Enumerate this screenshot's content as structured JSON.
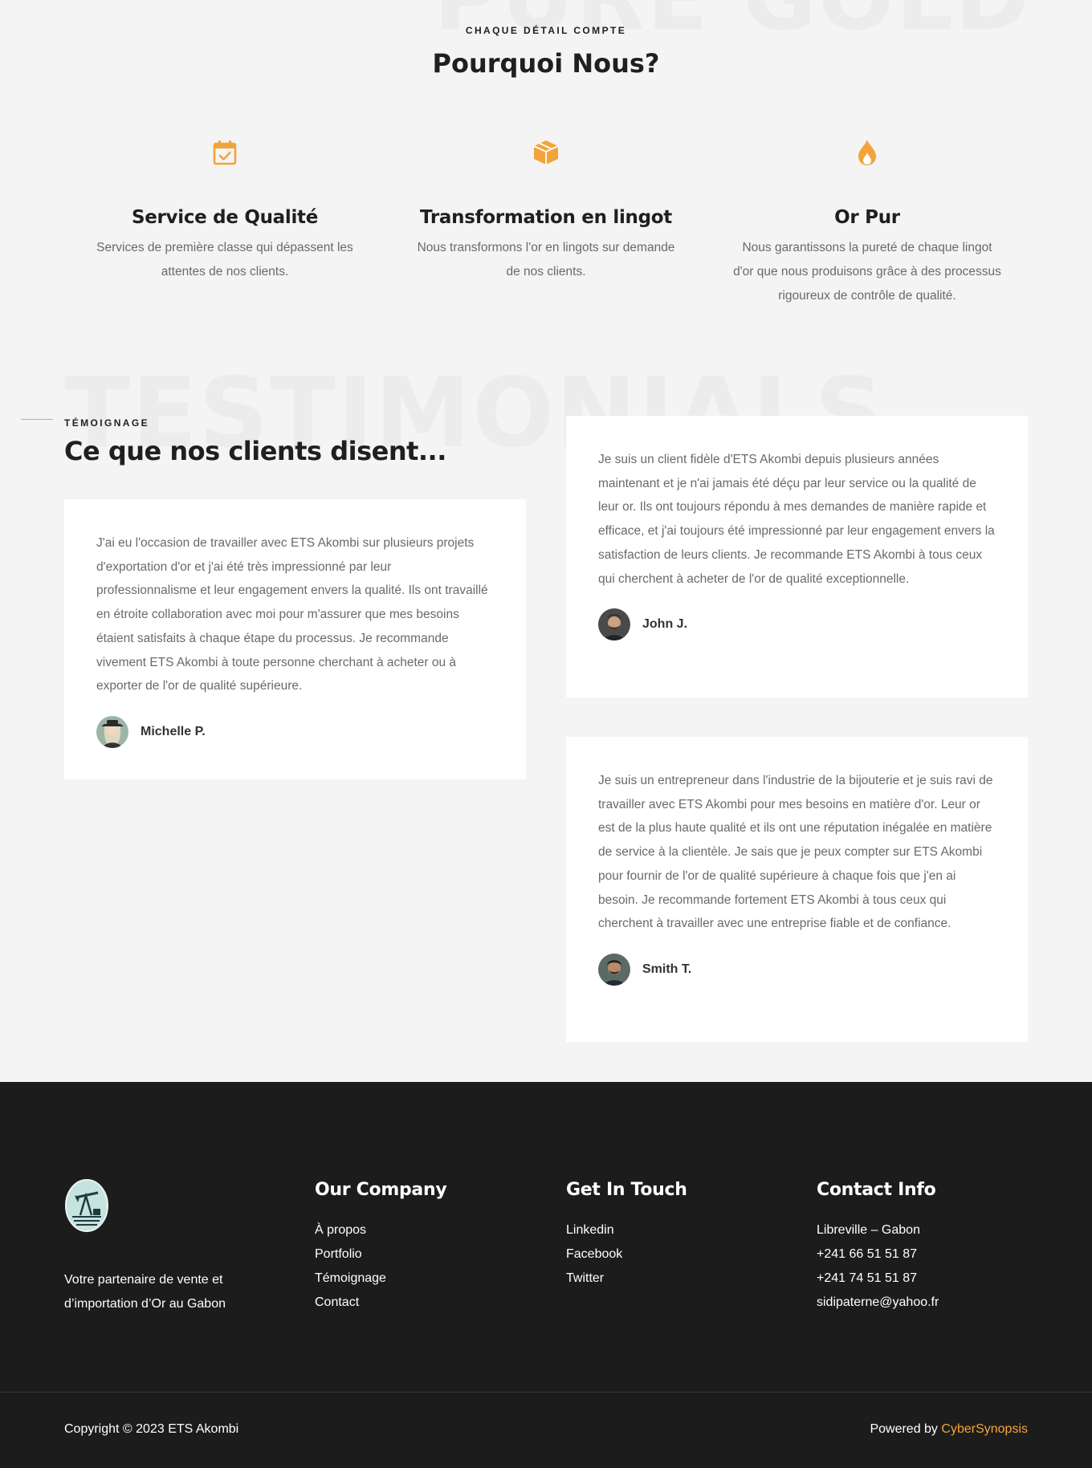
{
  "colors": {
    "accent": "#f2a43a",
    "footer_bg": "#1c1c1c",
    "page_bg": "#f4f4f4"
  },
  "why": {
    "background_word": "PURE GOLD",
    "eyebrow": "CHAQUE DÉTAIL COMPTE",
    "title": "Pourquoi Nous?",
    "features": [
      {
        "icon": "calendar-check-icon",
        "title": "Service de Qualité",
        "text": "Services de première classe qui dépassent les attentes de nos clients."
      },
      {
        "icon": "cube-icon",
        "title": "Transformation en lingot",
        "text": "Nous transformons l'or en lingots sur demande de nos clients."
      },
      {
        "icon": "flame-icon",
        "title": "Or Pur",
        "text": "Nous garantissons la pureté de chaque lingot d'or que nous produisons grâce à des processus rigoureux de contrôle de qualité."
      }
    ]
  },
  "testimonials": {
    "background_word": "TESTIMONIALS",
    "eyebrow": "TÉMOIGNAGE",
    "title": "Ce que nos clients disent...",
    "items": [
      {
        "text": "J'ai eu l'occasion de travailler avec ETS Akombi sur plusieurs projets d'exportation d'or et j'ai été très impressionné par leur professionnalisme et leur engagement envers la qualité. Ils ont travaillé en étroite collaboration avec moi pour m'assurer que mes besoins étaient satisfaits à chaque étape du processus. Je recommande vivement ETS Akombi à toute personne cherchant à acheter ou à exporter de l'or de qualité supérieure.",
        "author": "Michelle P."
      },
      {
        "text": "Je suis un client fidèle d'ETS Akombi depuis plusieurs années maintenant et je n'ai jamais été déçu par leur service ou la qualité de leur or. Ils ont toujours répondu à mes demandes de manière rapide et efficace, et j'ai toujours été impressionné par leur engagement envers la satisfaction de leurs clients. Je recommande ETS Akombi à tous ceux qui cherchent à acheter de l'or de qualité exceptionnelle.",
        "author": "John J."
      },
      {
        "text": "Je suis un entrepreneur dans l'industrie de la bijouterie et je suis ravi de travailler avec ETS Akombi pour mes besoins en matière d'or. Leur or est de la plus haute qualité et ils ont une réputation inégalée en matière de service à la clientèle. Je sais que je peux compter sur ETS Akombi pour fournir de l'or de qualité supérieure à chaque fois que j'en ai besoin. Je recommande fortement ETS Akombi à tous ceux qui cherchent à travailler avec une entreprise fiable et de confiance.",
        "author": "Smith T."
      }
    ]
  },
  "footer": {
    "tagline": "Votre partenaire de vente et d’importation d’Or au Gabon",
    "company": {
      "title": "Our Company",
      "links": [
        "À propos",
        "Portfolio",
        "Témoignage",
        "Contact"
      ]
    },
    "touch": {
      "title": "Get In Touch",
      "links": [
        "Linkedin",
        "Facebook",
        "Twitter"
      ]
    },
    "contact": {
      "title": "Contact Info",
      "lines": [
        "Libreville – Gabon",
        "+241 66 51 51 87",
        "+241 74 51 51 87",
        "sidipaterne@yahoo.fr"
      ]
    },
    "copyright": "Copyright © 2023 ETS Akombi",
    "powered_prefix": "Powered by",
    "powered_brand": "CyberSynopsis"
  }
}
